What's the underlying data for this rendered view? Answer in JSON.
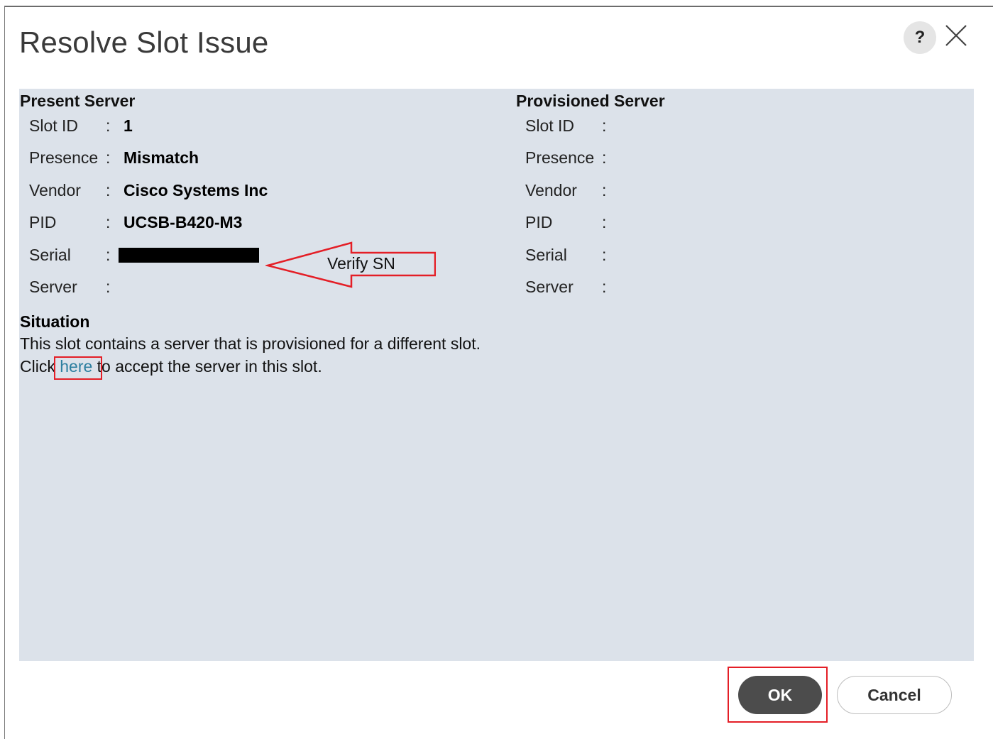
{
  "dialog": {
    "title": "Resolve Slot Issue",
    "help_label": "?",
    "close_icon": "close-icon"
  },
  "present": {
    "heading": "Present Server",
    "rows": [
      {
        "label": "Slot ID",
        "value": "1"
      },
      {
        "label": "Presence",
        "value": "Mismatch"
      },
      {
        "label": "Vendor",
        "value": "Cisco Systems Inc"
      },
      {
        "label": "PID",
        "value": "UCSB-B420-M3"
      },
      {
        "label": "Serial",
        "value": ""
      },
      {
        "label": "Server",
        "value": ""
      }
    ]
  },
  "provisioned": {
    "heading": "Provisioned Server",
    "rows": [
      {
        "label": "Slot ID"
      },
      {
        "label": "Presence"
      },
      {
        "label": "Vendor"
      },
      {
        "label": "PID"
      },
      {
        "label": "Serial"
      },
      {
        "label": "Server"
      }
    ]
  },
  "colon": ":",
  "annotation": {
    "verify_text": "Verify SN",
    "color": "#e41e26"
  },
  "situation": {
    "heading": "Situation",
    "line1": "This slot contains a server that is provisioned for a different slot.",
    "line2_prefix": "Click",
    "link_text": "here",
    "line2_suffix": "to accept the server in this slot."
  },
  "buttons": {
    "ok": "OK",
    "cancel": "Cancel"
  },
  "colors": {
    "panel_bg": "#dce2ea",
    "ok_bg": "#4c4c4c",
    "link": "#2d7fa0"
  }
}
